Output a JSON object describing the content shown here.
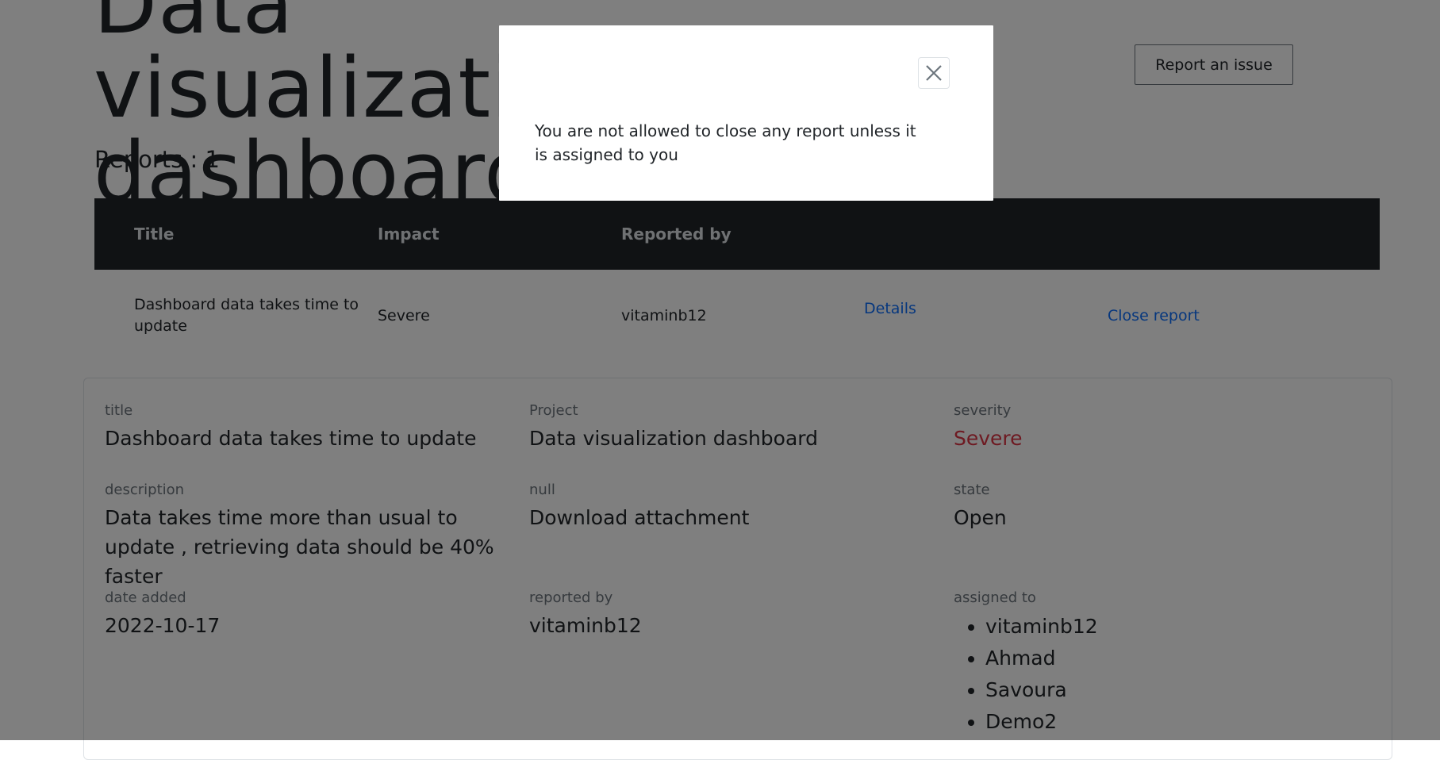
{
  "header": {
    "title": "Data visualization dashboard",
    "report_button": "Report an issue",
    "reports_count": "Reports : 1"
  },
  "table": {
    "columns": [
      "Title",
      "Impact",
      "Reported by"
    ],
    "rows": [
      {
        "title": "Dashboard data takes time to update",
        "impact": "Severe",
        "reported_by": "vitaminb12",
        "details_link": "Details",
        "close_link": "Close report"
      }
    ]
  },
  "details": {
    "title_label": "title",
    "title_value": "Dashboard data takes time to update",
    "project_label": "Project",
    "project_value": "Data visualization dashboard",
    "severity_label": "severity",
    "severity_value": "Severe",
    "description_label": "description",
    "description_value": "Data takes time more than usual to update , retrieving data should be 40% faster",
    "attachment_label": "null",
    "attachment_value": "Download attachment",
    "state_label": "state",
    "state_value": "Open",
    "date_label": "date added",
    "date_value": "2022-10-17",
    "reported_label": "reported by",
    "reported_value": "vitaminb12",
    "assigned_label": "assigned to",
    "assigned_to": [
      "vitaminb12",
      "Ahmad",
      "Savoura",
      "Demo2"
    ]
  },
  "modal": {
    "message": "You are not allowed to close any report unless it is assigned to you",
    "close_icon": "close-icon"
  },
  "colors": {
    "table_header_bg": "#212529",
    "link": "#0d6efd",
    "severity": "#dc3545",
    "backdrop": "rgba(0,0,0,0.5)"
  }
}
